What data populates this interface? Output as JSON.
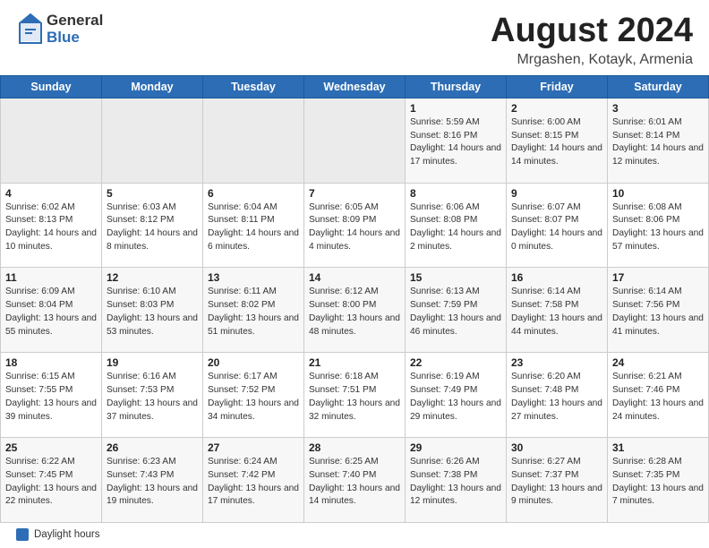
{
  "header": {
    "logo_general": "General",
    "logo_blue": "Blue",
    "month_title": "August 2024",
    "location": "Mrgashen, Kotayk, Armenia"
  },
  "days_of_week": [
    "Sunday",
    "Monday",
    "Tuesday",
    "Wednesday",
    "Thursday",
    "Friday",
    "Saturday"
  ],
  "footer": {
    "legend_label": "Daylight hours"
  },
  "weeks": [
    [
      {
        "day": "",
        "info": ""
      },
      {
        "day": "",
        "info": ""
      },
      {
        "day": "",
        "info": ""
      },
      {
        "day": "",
        "info": ""
      },
      {
        "day": "1",
        "info": "Sunrise: 5:59 AM\nSunset: 8:16 PM\nDaylight: 14 hours and 17 minutes."
      },
      {
        "day": "2",
        "info": "Sunrise: 6:00 AM\nSunset: 8:15 PM\nDaylight: 14 hours and 14 minutes."
      },
      {
        "day": "3",
        "info": "Sunrise: 6:01 AM\nSunset: 8:14 PM\nDaylight: 14 hours and 12 minutes."
      }
    ],
    [
      {
        "day": "4",
        "info": "Sunrise: 6:02 AM\nSunset: 8:13 PM\nDaylight: 14 hours and 10 minutes."
      },
      {
        "day": "5",
        "info": "Sunrise: 6:03 AM\nSunset: 8:12 PM\nDaylight: 14 hours and 8 minutes."
      },
      {
        "day": "6",
        "info": "Sunrise: 6:04 AM\nSunset: 8:11 PM\nDaylight: 14 hours and 6 minutes."
      },
      {
        "day": "7",
        "info": "Sunrise: 6:05 AM\nSunset: 8:09 PM\nDaylight: 14 hours and 4 minutes."
      },
      {
        "day": "8",
        "info": "Sunrise: 6:06 AM\nSunset: 8:08 PM\nDaylight: 14 hours and 2 minutes."
      },
      {
        "day": "9",
        "info": "Sunrise: 6:07 AM\nSunset: 8:07 PM\nDaylight: 14 hours and 0 minutes."
      },
      {
        "day": "10",
        "info": "Sunrise: 6:08 AM\nSunset: 8:06 PM\nDaylight: 13 hours and 57 minutes."
      }
    ],
    [
      {
        "day": "11",
        "info": "Sunrise: 6:09 AM\nSunset: 8:04 PM\nDaylight: 13 hours and 55 minutes."
      },
      {
        "day": "12",
        "info": "Sunrise: 6:10 AM\nSunset: 8:03 PM\nDaylight: 13 hours and 53 minutes."
      },
      {
        "day": "13",
        "info": "Sunrise: 6:11 AM\nSunset: 8:02 PM\nDaylight: 13 hours and 51 minutes."
      },
      {
        "day": "14",
        "info": "Sunrise: 6:12 AM\nSunset: 8:00 PM\nDaylight: 13 hours and 48 minutes."
      },
      {
        "day": "15",
        "info": "Sunrise: 6:13 AM\nSunset: 7:59 PM\nDaylight: 13 hours and 46 minutes."
      },
      {
        "day": "16",
        "info": "Sunrise: 6:14 AM\nSunset: 7:58 PM\nDaylight: 13 hours and 44 minutes."
      },
      {
        "day": "17",
        "info": "Sunrise: 6:14 AM\nSunset: 7:56 PM\nDaylight: 13 hours and 41 minutes."
      }
    ],
    [
      {
        "day": "18",
        "info": "Sunrise: 6:15 AM\nSunset: 7:55 PM\nDaylight: 13 hours and 39 minutes."
      },
      {
        "day": "19",
        "info": "Sunrise: 6:16 AM\nSunset: 7:53 PM\nDaylight: 13 hours and 37 minutes."
      },
      {
        "day": "20",
        "info": "Sunrise: 6:17 AM\nSunset: 7:52 PM\nDaylight: 13 hours and 34 minutes."
      },
      {
        "day": "21",
        "info": "Sunrise: 6:18 AM\nSunset: 7:51 PM\nDaylight: 13 hours and 32 minutes."
      },
      {
        "day": "22",
        "info": "Sunrise: 6:19 AM\nSunset: 7:49 PM\nDaylight: 13 hours and 29 minutes."
      },
      {
        "day": "23",
        "info": "Sunrise: 6:20 AM\nSunset: 7:48 PM\nDaylight: 13 hours and 27 minutes."
      },
      {
        "day": "24",
        "info": "Sunrise: 6:21 AM\nSunset: 7:46 PM\nDaylight: 13 hours and 24 minutes."
      }
    ],
    [
      {
        "day": "25",
        "info": "Sunrise: 6:22 AM\nSunset: 7:45 PM\nDaylight: 13 hours and 22 minutes."
      },
      {
        "day": "26",
        "info": "Sunrise: 6:23 AM\nSunset: 7:43 PM\nDaylight: 13 hours and 19 minutes."
      },
      {
        "day": "27",
        "info": "Sunrise: 6:24 AM\nSunset: 7:42 PM\nDaylight: 13 hours and 17 minutes."
      },
      {
        "day": "28",
        "info": "Sunrise: 6:25 AM\nSunset: 7:40 PM\nDaylight: 13 hours and 14 minutes."
      },
      {
        "day": "29",
        "info": "Sunrise: 6:26 AM\nSunset: 7:38 PM\nDaylight: 13 hours and 12 minutes."
      },
      {
        "day": "30",
        "info": "Sunrise: 6:27 AM\nSunset: 7:37 PM\nDaylight: 13 hours and 9 minutes."
      },
      {
        "day": "31",
        "info": "Sunrise: 6:28 AM\nSunset: 7:35 PM\nDaylight: 13 hours and 7 minutes."
      }
    ]
  ]
}
